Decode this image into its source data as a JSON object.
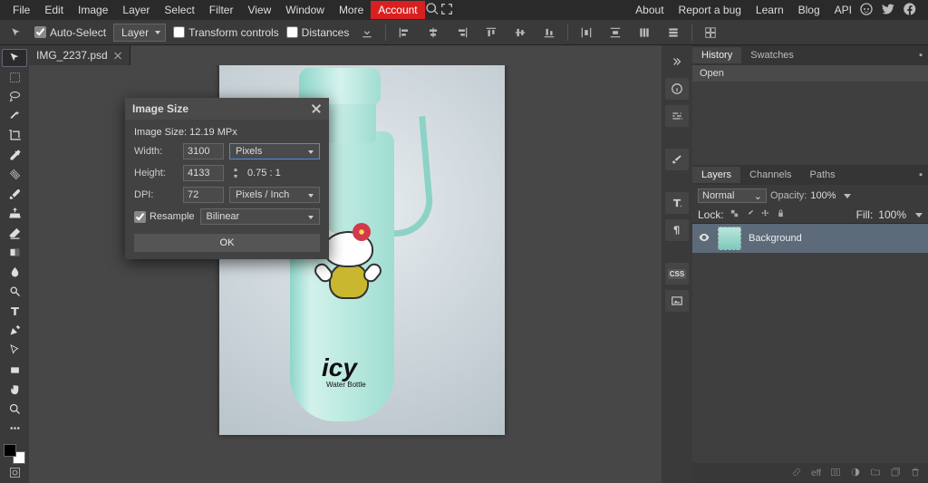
{
  "menu": {
    "items": [
      "File",
      "Edit",
      "Image",
      "Layer",
      "Select",
      "Filter",
      "View",
      "Window",
      "More"
    ],
    "account": "Account",
    "right": [
      "About",
      "Report a bug",
      "Learn",
      "Blog",
      "API"
    ]
  },
  "options": {
    "auto_select": "Auto-Select",
    "layer_dropdown": "Layer",
    "transform_controls": "Transform controls",
    "distances": "Distances"
  },
  "doc_tab": "IMG_2237.psd",
  "dialog": {
    "title": "Image Size",
    "info": "Image Size: 12.19 MPx",
    "width_label": "Width:",
    "width_value": "3100",
    "width_unit": "Pixels",
    "height_label": "Height:",
    "height_value": "4133",
    "ratio": "0.75 : 1",
    "dpi_label": "DPI:",
    "dpi_value": "72",
    "dpi_unit": "Pixels / Inch",
    "resample": "Resample",
    "resample_method": "Bilinear",
    "ok": "OK"
  },
  "canvas": {
    "brand": "icy",
    "brand_sub": "Water Bottle"
  },
  "history": {
    "tabs": [
      "History",
      "Swatches"
    ],
    "open": "Open"
  },
  "layers": {
    "tabs": [
      "Layers",
      "Channels",
      "Paths"
    ],
    "blend": "Normal",
    "opacity_label": "Opacity:",
    "opacity_value": "100%",
    "lock_label": "Lock:",
    "fill_label": "Fill:",
    "fill_value": "100%",
    "layer0": "Background"
  },
  "footer": {
    "eff": "eff"
  }
}
